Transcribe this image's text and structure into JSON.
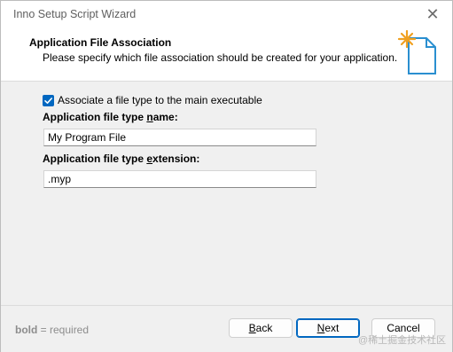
{
  "window": {
    "title": "Inno Setup Script Wizard",
    "close_glyph": "✕"
  },
  "header": {
    "title": "Application File Association",
    "subtitle": "Please specify which file association should be created for your application.",
    "icon": "document-sparkle-icon"
  },
  "form": {
    "associate_checkbox": {
      "checked": true,
      "label": "Associate a file type to the main executable"
    },
    "type_name": {
      "label_prefix": "Application file type ",
      "label_accel": "n",
      "label_suffix": "ame:",
      "value": "My Program File"
    },
    "type_extension": {
      "label_prefix": "Application file type ",
      "label_accel": "e",
      "label_suffix": "xtension:",
      "value": ".myp"
    }
  },
  "footer": {
    "legend_bold": "bold",
    "legend_rest": " = required",
    "back": {
      "accel": "B",
      "rest": "ack"
    },
    "next": {
      "accel": "N",
      "rest": "ext"
    },
    "cancel": "Cancel"
  },
  "watermark": "@稀土掘金技术社区",
  "colors": {
    "accent": "#0067c0",
    "icon_blue": "#2a8fd0",
    "icon_orange": "#f0a020",
    "footer_bg": "#f0f0f0"
  }
}
